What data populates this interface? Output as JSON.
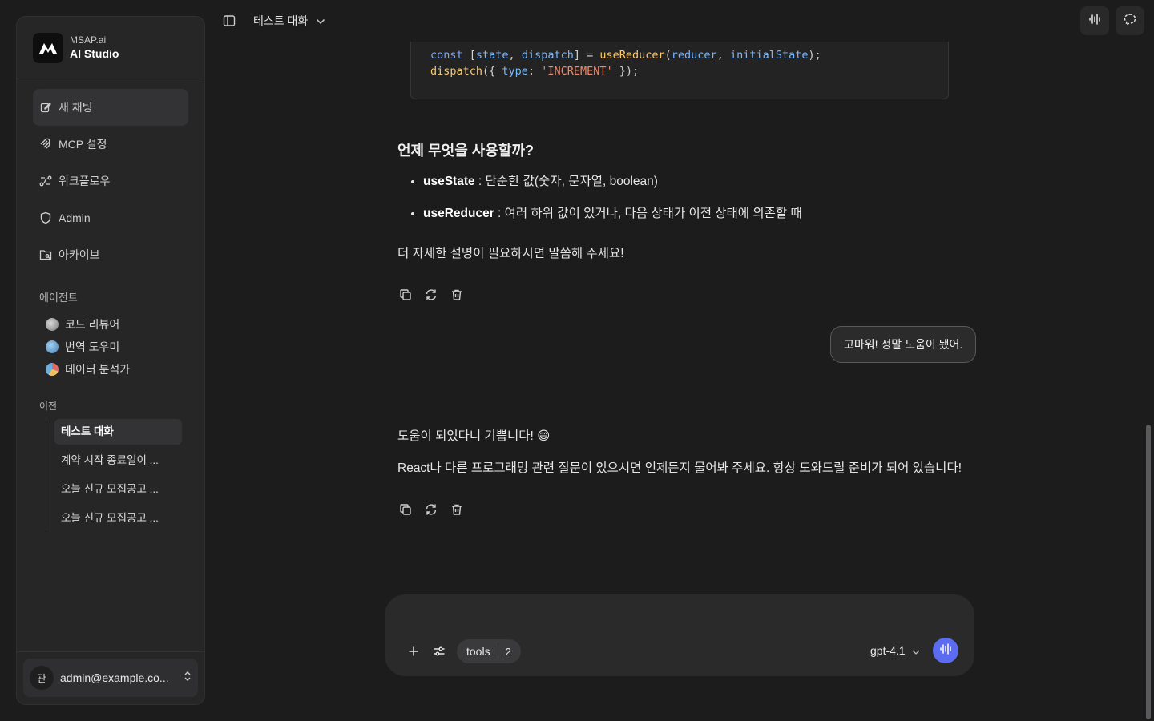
{
  "brand": {
    "small": "MSAP.ai",
    "big": "AI Studio"
  },
  "nav": [
    {
      "label": "새 채팅",
      "icon": "edit-icon"
    },
    {
      "label": "MCP 설정",
      "icon": "mcp-icon"
    },
    {
      "label": "워크플로우",
      "icon": "workflow-icon"
    },
    {
      "label": "Admin",
      "icon": "shield-icon"
    },
    {
      "label": "아카이브",
      "icon": "archive-icon"
    }
  ],
  "agents": {
    "title": "에이전트",
    "items": [
      {
        "label": "코드 리뷰어",
        "color": "#a8a8a8"
      },
      {
        "label": "번역 도우미",
        "color": "#6fa8d8"
      },
      {
        "label": "데이터 분석가",
        "color": "#e06a6a"
      }
    ]
  },
  "history": {
    "title": "이전",
    "items": [
      "테스트 대화",
      "계약 시작 종료일이 ...",
      "오늘 신규 모집공고 ...",
      "오늘 신규 모집공고 ..."
    ]
  },
  "user": {
    "initial": "관",
    "email": "admin@example.co..."
  },
  "topbar": {
    "title": "테스트 대화"
  },
  "code": {
    "line1": {
      "k": "const",
      "p1": " [",
      "v1": "state",
      "p2": ", ",
      "v2": "dispatch",
      "p3": "] = ",
      "f": "useReducer",
      "p4": "(",
      "v3": "reducer",
      "p5": ", ",
      "v4": "initialState",
      "p6": ");"
    },
    "line2": {
      "f": "dispatch",
      "p1": "({ ",
      "v": "type",
      "p2": ": ",
      "s": "'INCREMENT'",
      "p3": " });"
    }
  },
  "answer": {
    "heading": "언제 무엇을 사용할까?",
    "bullets": [
      {
        "term": "useState",
        "desc": " : 단순한 값(숫자, 문자열, boolean)"
      },
      {
        "term": "useReducer",
        "desc": " : 여러 하위 값이 있거나, 다음 상태가 이전 상태에 의존할 때"
      }
    ],
    "closing": "더 자세한 설명이 필요하시면 말씀해 주세요!"
  },
  "user_message": "고마워! 정말 도움이 됐어.",
  "reply": {
    "line1": "도움이 되었다니 기쁩니다! 😄",
    "line2": "React나 다른 프로그래밍 관련 질문이 있으시면 언제든지 물어봐 주세요. 항상 도와드릴 준비가 되어 있습니다!"
  },
  "composer": {
    "tools_label": "tools",
    "tools_count": "2",
    "model": "gpt-4.1"
  }
}
